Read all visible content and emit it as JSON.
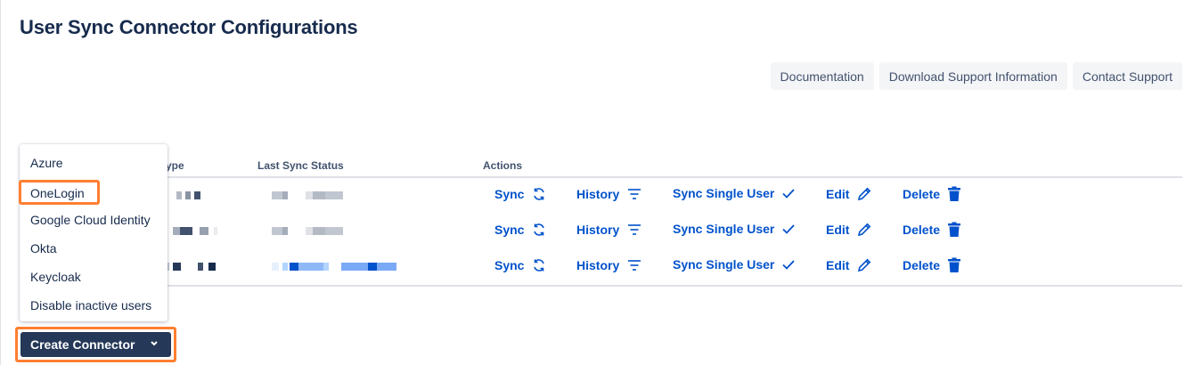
{
  "page": {
    "title": "User Sync Connector Configurations"
  },
  "toolbar": {
    "buttons": [
      "Documentation",
      "Download Support Information",
      "Contact Support"
    ]
  },
  "table": {
    "headers": {
      "type": "ype",
      "last_sync_status": "Last Sync Status",
      "actions": "Actions"
    },
    "actions": {
      "sync": "Sync",
      "history": "History",
      "sync_single_user": "Sync Single User",
      "edit": "Edit",
      "delete": "Delete"
    },
    "row_count": 3
  },
  "dropdown": {
    "items": [
      "Azure",
      "OneLogin",
      "Google Cloud Identity",
      "Okta",
      "Keycloak",
      "Disable inactive users"
    ]
  },
  "create_connector": {
    "label": "Create Connector"
  },
  "colors": {
    "accent": "#0052cc",
    "primary_button": "#253858",
    "highlight": "#ff7f31"
  }
}
